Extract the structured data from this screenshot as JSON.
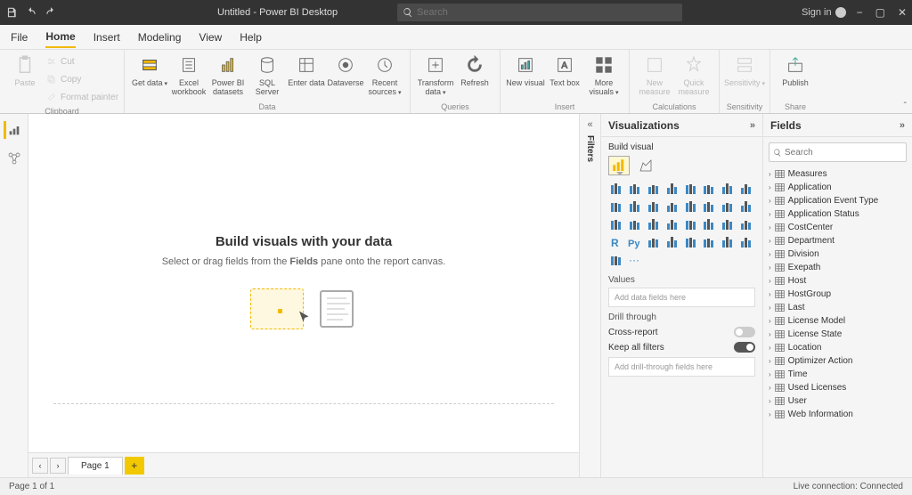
{
  "titlebar": {
    "title": "Untitled - Power BI Desktop",
    "search_placeholder": "Search",
    "signin": "Sign in"
  },
  "menu": {
    "file": "File",
    "home": "Home",
    "insert": "Insert",
    "modeling": "Modeling",
    "view": "View",
    "help": "Help"
  },
  "ribbon": {
    "clipboard": {
      "paste": "Paste",
      "cut": "Cut",
      "copy": "Copy",
      "formatpainter": "Format painter",
      "label": "Clipboard"
    },
    "data": {
      "getdata": "Get data",
      "excel": "Excel workbook",
      "pbidata": "Power BI datasets",
      "sql": "SQL Server",
      "enter": "Enter data",
      "dataverse": "Dataverse",
      "recent": "Recent sources",
      "label": "Data"
    },
    "queries": {
      "transform": "Transform data",
      "refresh": "Refresh",
      "label": "Queries"
    },
    "insert": {
      "newvisual": "New visual",
      "textbox": "Text box",
      "morevisuals": "More visuals",
      "label": "Insert"
    },
    "calculations": {
      "newmeasure": "New measure",
      "quickmeasure": "Quick measure",
      "label": "Calculations"
    },
    "sensitivity": {
      "sensitivity": "Sensitivity",
      "label": "Sensitivity"
    },
    "share": {
      "publish": "Publish",
      "label": "Share"
    }
  },
  "filters_label": "Filters",
  "canvas": {
    "title": "Build visuals with your data",
    "subtitle_pre": "Select or drag fields from the ",
    "subtitle_bold": "Fields",
    "subtitle_post": " pane onto the report canvas."
  },
  "pages": {
    "page1": "Page 1"
  },
  "viz": {
    "title": "Visualizations",
    "build": "Build visual",
    "values": "Values",
    "values_placeholder": "Add data fields here",
    "drill": "Drill through",
    "crossreport": "Cross-report",
    "keepfilters": "Keep all filters",
    "drill_placeholder": "Add drill-through fields here"
  },
  "fields": {
    "title": "Fields",
    "search_placeholder": "Search",
    "items": [
      "Measures",
      "Application",
      "Application Event Type",
      "Application Status",
      "CostCenter",
      "Department",
      "Division",
      "Exepath",
      "Host",
      "HostGroup",
      "Last",
      "License Model",
      "License State",
      "Location",
      "Optimizer Action",
      "Time",
      "Used Licenses",
      "User",
      "Web Information"
    ]
  },
  "status": {
    "left": "Page 1 of 1",
    "right": "Live connection: Connected"
  }
}
